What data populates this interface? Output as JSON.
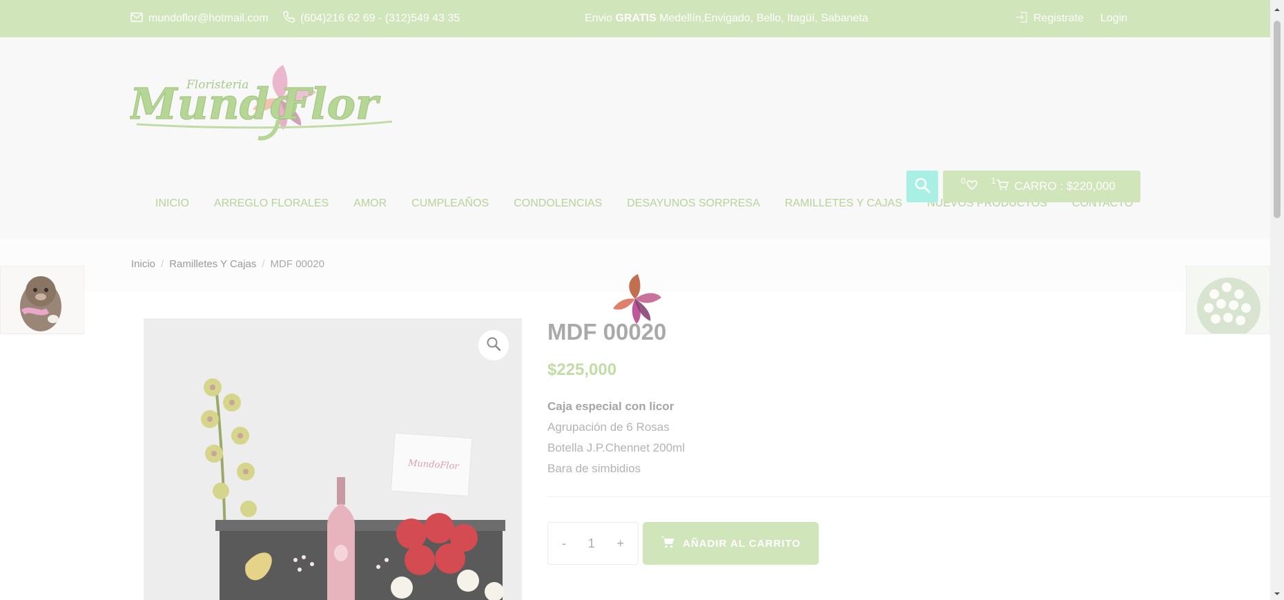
{
  "topbar": {
    "email": "mundoflor@hotmail.com",
    "phones": "(604)216 62 69 - (312)549 43 35",
    "promo_prefix": "Envio ",
    "promo_bold": "GRATIS",
    "promo_suffix": " Medellín,Envigado, Bello, Itagüí, Sabaneta",
    "register": "Registrate",
    "login": "Login"
  },
  "nav": {
    "items": [
      "INICIO",
      "ARREGLO FLORALES",
      "AMOR",
      "CUMPLEAÑOS",
      "CONDOLENCIAS",
      "DESAYUNOS SORPRESA",
      "RAMILLETES Y CAJAS",
      "NUEVOS PRODUCTOS",
      "CONTACTO"
    ]
  },
  "cart": {
    "wishlist_count": "0",
    "cart_count": "1",
    "label": "CARRO : $220,000"
  },
  "breadcrumb": {
    "items": [
      "Inicio",
      "Ramilletes Y Cajas",
      "MDF 00020"
    ]
  },
  "product": {
    "title": "MDF 00020",
    "price": "$225,000",
    "desc_lead": "Caja especial con licor",
    "desc_lines": [
      "Agrupación de 6 Rosas",
      "Botella J.P.Chennet 200ml",
      "Bara de simbidios"
    ],
    "quantity": "1",
    "minus": "-",
    "plus": "+",
    "add_to_cart": "AÑADIR AL CARRITO"
  },
  "colors": {
    "accent_green": "#d1e5ba",
    "nav_green": "#b6d39a",
    "search_teal": "#a8efe4"
  }
}
